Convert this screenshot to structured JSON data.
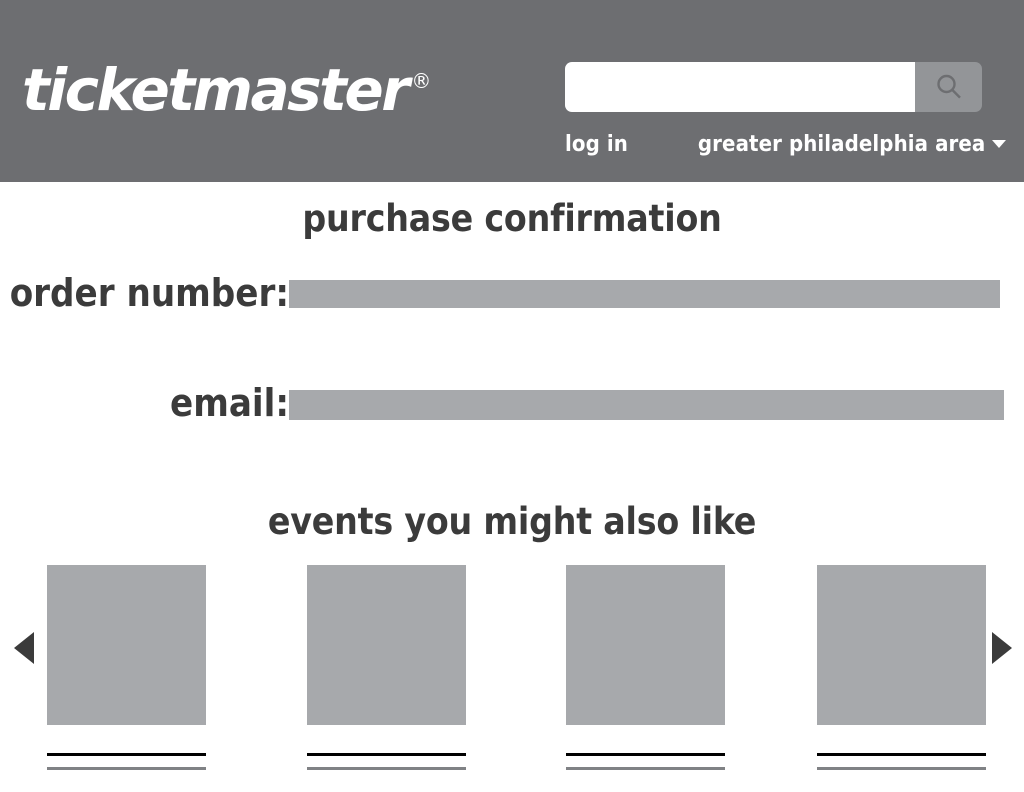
{
  "header": {
    "logo_text": "ticketmaster",
    "logo_registered": "®",
    "background_color": "#6d6e71",
    "search": {
      "value": "",
      "placeholder": "",
      "icon": "search-icon",
      "button_background": "#939598"
    },
    "links": [
      {
        "label": "log in",
        "name": "log-in-link"
      },
      {
        "label": "greater philadelphia area",
        "name": "location-selector",
        "has_caret": true
      }
    ]
  },
  "main": {
    "page_title": "purchase confirmation",
    "fields": [
      {
        "label": "order number:",
        "value": "",
        "name": "order-number"
      },
      {
        "label": "email:",
        "value": "",
        "name": "email"
      }
    ],
    "placeholder_color": "#a7a9ac",
    "text_color": "#3b3b3b"
  },
  "carousel": {
    "title": "events you might also like",
    "prev_label": "◀",
    "next_label": "▶",
    "cards": [
      {
        "image_placeholder": "",
        "line_1": "",
        "line_2": ""
      },
      {
        "image_placeholder": "",
        "line_1": "",
        "line_2": ""
      },
      {
        "image_placeholder": "",
        "line_1": "",
        "line_2": ""
      },
      {
        "image_placeholder": "",
        "line_1": "",
        "line_2": ""
      }
    ]
  }
}
